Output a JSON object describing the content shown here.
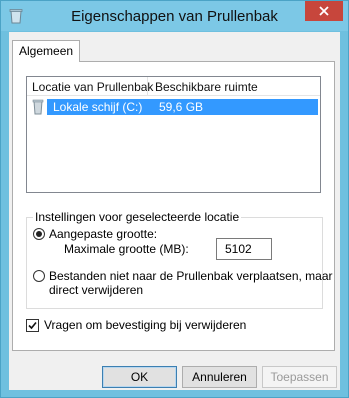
{
  "window": {
    "title": "Eigenschappen van Prullenbak",
    "close_label": "close-icon"
  },
  "tabs": [
    {
      "label": "Algemeen",
      "selected": true
    }
  ],
  "list": {
    "columns": [
      "Locatie van Prullenbak",
      "Beschikbare ruimte"
    ],
    "rows": [
      {
        "location": "Lokale schijf (C:)",
        "space": "59,6 GB",
        "selected": true,
        "icon": "recycle-bin-icon"
      }
    ]
  },
  "settings": {
    "group_title": "Instellingen voor geselecteerde locatie",
    "custom_size_label": "Aangepaste grootte:",
    "custom_size_selected": true,
    "max_size_label": "Maximale grootte (MB):",
    "max_size_value": "5102",
    "no_recycle_label_line1": "Bestanden niet naar de Prullenbak verplaatsen, maar",
    "no_recycle_label_line2": "direct verwijderen",
    "no_recycle_selected": false
  },
  "confirm": {
    "label": "Vragen om bevestiging bij verwijderen",
    "checked": true
  },
  "buttons": {
    "ok": "OK",
    "cancel": "Annuleren",
    "apply": "Toepassen",
    "apply_enabled": false
  },
  "colors": {
    "title_bar": "#7cc8e6",
    "close_button": "#c7463c",
    "selection": "#3399ff"
  }
}
